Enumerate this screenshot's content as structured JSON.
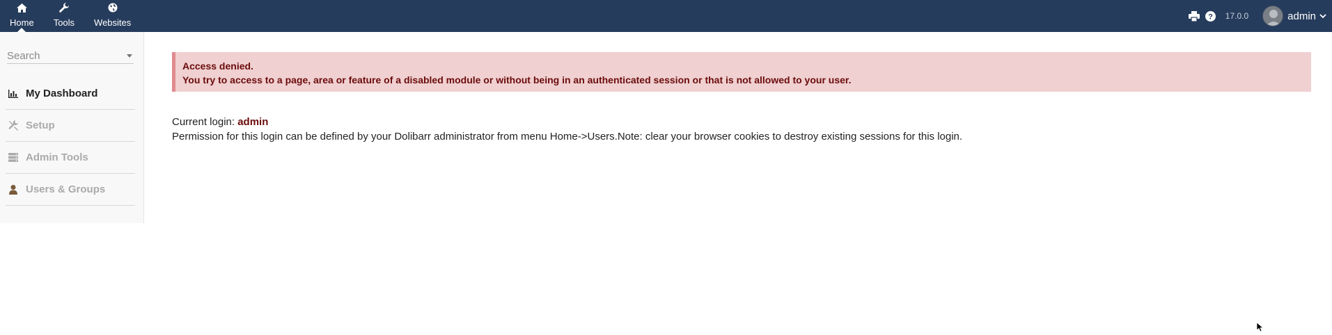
{
  "topbar": {
    "menu": [
      {
        "label": "Home",
        "icon": "home-icon",
        "active": true
      },
      {
        "label": "Tools",
        "icon": "wrench-icon"
      },
      {
        "label": "Websites",
        "icon": "globe-icon"
      }
    ],
    "version": "17.0.0",
    "username": "admin"
  },
  "sidebar": {
    "search_placeholder": "Search",
    "items": [
      {
        "label": "My Dashboard",
        "icon": "chart-icon",
        "active": true
      },
      {
        "label": "Setup",
        "icon": "tools-icon"
      },
      {
        "label": "Admin Tools",
        "icon": "server-icon"
      },
      {
        "label": "Users & Groups",
        "icon": "user-icon"
      }
    ]
  },
  "alert": {
    "title": "Access denied.",
    "message": "You try to access to a page, area or feature of a disabled module or without being in an authenticated session or that is not allowed to your user."
  },
  "content": {
    "current_login_label": "Current login: ",
    "current_login_user": "admin",
    "permission_note": "Permission for this login can be defined by your Dolibarr administrator from menu Home->Users.Note: clear your browser cookies to destroy existing sessions for this login."
  },
  "colors": {
    "topbar_bg": "#263c5c",
    "alert_bg": "#f0d0d1",
    "alert_text": "#6b0b0b"
  }
}
